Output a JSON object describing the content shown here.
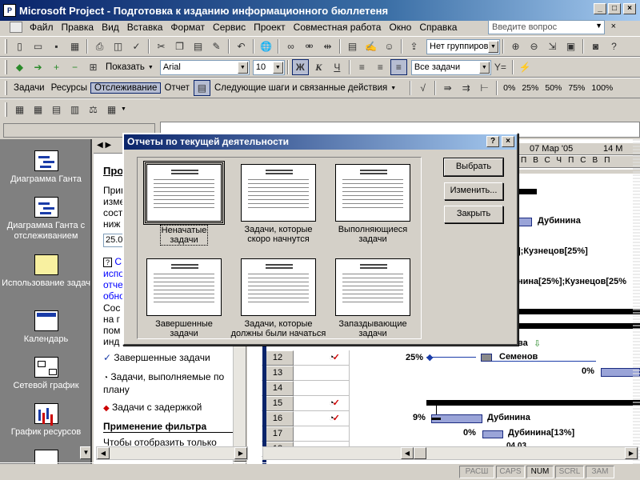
{
  "window": {
    "title": "Microsoft Project - Подготовка к изданию информационного бюллетеня"
  },
  "menu": [
    "Файл",
    "Правка",
    "Вид",
    "Вставка",
    "Формат",
    "Сервис",
    "Проект",
    "Совместная работа",
    "Окно",
    "Справка"
  ],
  "help_box": {
    "placeholder": "Введите вопрос"
  },
  "toolbar_std": {
    "grouping": "Нет группировки"
  },
  "toolbar_fmt": {
    "show_label": "Показать",
    "font": "Arial",
    "size": "10",
    "bold": "Ж",
    "italic": "К",
    "underline": "Ч",
    "filter": "Все задачи"
  },
  "toolbar_track": {
    "items": [
      "Задачи",
      "Ресурсы",
      "Отслеживание",
      "Отчет"
    ],
    "next_steps": "Следующие шаги и связанные действия",
    "percents": [
      "0%",
      "25%",
      "50%",
      "75%",
      "100%"
    ]
  },
  "viewbar": [
    {
      "label": "Диаграмма Ганта",
      "icon": "gantt-chart-icon"
    },
    {
      "label": "Диаграмма Ганта с отслеживанием",
      "icon": "tracking-gantt-icon"
    },
    {
      "label": "Использование задач",
      "icon": "task-usage-icon"
    },
    {
      "label": "Календарь",
      "icon": "calendar-icon"
    },
    {
      "label": "Сетевой график",
      "icon": "network-diagram-icon"
    },
    {
      "label": "График ресурсов",
      "icon": "resource-graph-icon"
    }
  ],
  "sidepane": {
    "title": "Про",
    "para1": [
      "Приме",
      "изме",
      "сост",
      "ниж"
    ],
    "value": "25.0",
    "link_lines": [
      "С",
      "испо",
      "отче",
      "обно"
    ],
    "para2": [
      "Сос",
      "на г",
      "пом",
      "инд"
    ],
    "items": [
      "Завершенные задачи",
      "Задачи, выполняемые по плану",
      "Задачи с задержкой"
    ],
    "section_title": "Применение фильтра",
    "section_text": "Чтобы отобразить только"
  },
  "table": {
    "rows": [
      "12",
      "13",
      "14",
      "15",
      "16",
      "17",
      "18"
    ]
  },
  "gantt": {
    "timescale_date": "07 Мар '05",
    "timescale_date2": "14 М",
    "days": [
      "П",
      "В",
      "С",
      "Ч",
      "П",
      "С",
      "В",
      "П"
    ],
    "labels": {
      "dubinina1": "Дубинина",
      "kuz1": "];Кузнецов[25%]",
      "kuz2": "нина[25%];Кузнецов[25%",
      "va": "ва",
      "p25": "25%",
      "semenov": "Семенов",
      "p0a": "0%",
      "p9": "9%",
      "dubinina2": "Дубинина",
      "p0b": "0%",
      "dubinina3": "Дубинина[13%]",
      "date": "04.03"
    }
  },
  "dialog": {
    "title": "Отчеты по текущей деятельности",
    "reports": [
      {
        "label": [
          "Неначатые",
          "задачи"
        ],
        "selected": true
      },
      {
        "label": [
          "Задачи, которые",
          "скоро начнутся"
        ],
        "selected": false
      },
      {
        "label": [
          "Выполняющиеся",
          "задачи"
        ],
        "selected": false
      },
      {
        "label": [
          "Завершенные",
          "задачи"
        ],
        "selected": false
      },
      {
        "label": [
          "Задачи, которые",
          "должны были начаться"
        ],
        "selected": false
      },
      {
        "label": [
          "Запаздывающие",
          "задачи"
        ],
        "selected": false
      }
    ],
    "buttons": {
      "select": "Выбрать",
      "edit": "Изменить...",
      "close": "Закрыть"
    }
  },
  "statusbar": {
    "indicators": [
      "РАСШ",
      "CAPS",
      "NUM",
      "SCRL",
      "ЗАМ"
    ],
    "active": "NUM"
  }
}
